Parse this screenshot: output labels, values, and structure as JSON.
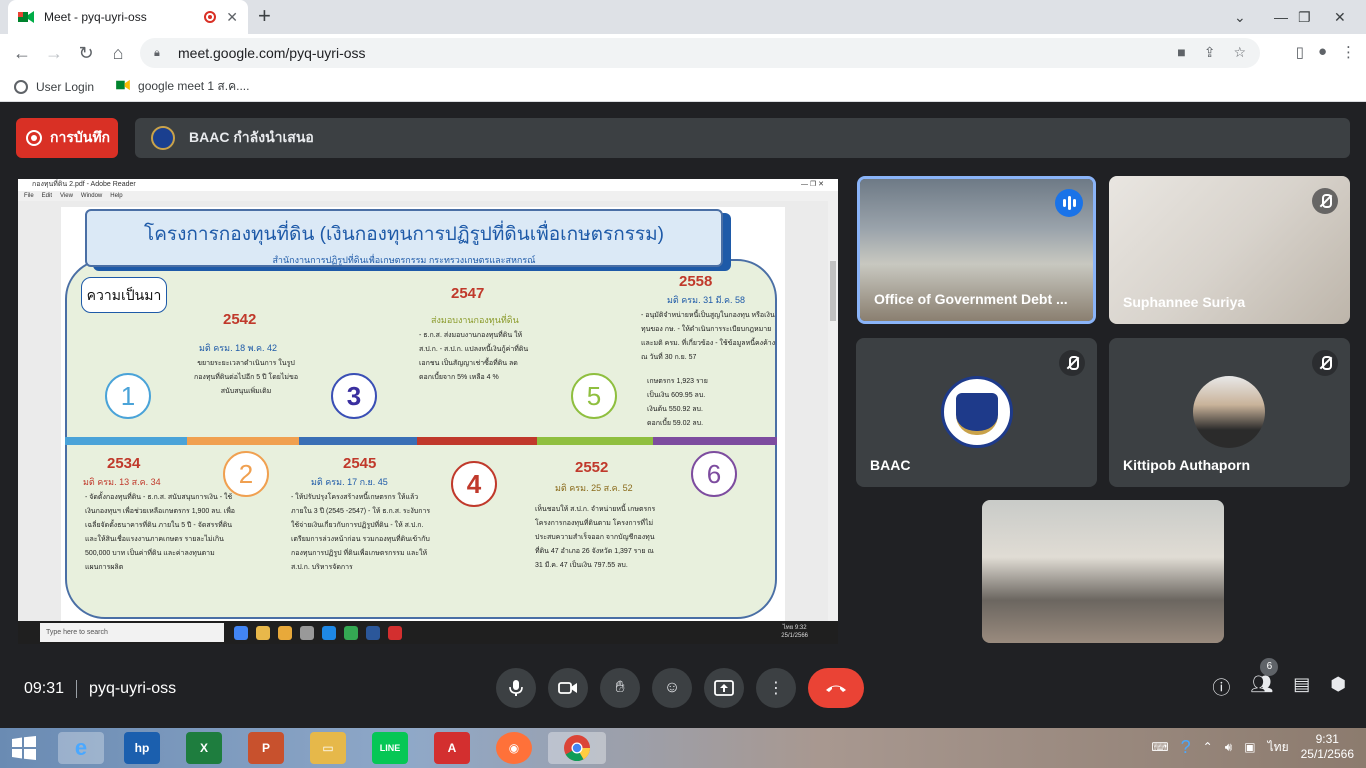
{
  "browser": {
    "tab_title": "Meet - pyq-uyri-oss",
    "tab_close": "✕",
    "new_tab": "+",
    "url": "meet.google.com/pyq-uyri-oss",
    "bookmarks": [
      "User Login",
      "google meet 1 ส.ค...."
    ]
  },
  "meet": {
    "recording_label": "การบันทึก",
    "presenting_label": "BAAC กำลังนำเสนอ",
    "meeting_code": "pyq-uyri-oss",
    "time": "09:31",
    "participant_count": "6"
  },
  "shared_screen": {
    "window_title": "กองทุนที่ดิน 2.pdf - Adobe Reader",
    "menu": [
      "File",
      "Edit",
      "View",
      "Window",
      "Help"
    ],
    "slide_title": "โครงการกองทุนที่ดิน (เงินกองทุนการปฏิรูปที่ดินเพื่อเกษตรกรรม)",
    "slide_subtitle": "สำนักงานการปฏิรูปที่ดินเพื่อเกษตรกรรม กระทรวงเกษตรและสหกรณ์",
    "history_label": "ความเป็นมา",
    "steps": [
      {
        "num": "1",
        "year": "2534",
        "resolution": "มติ ครม. 13 ส.ค. 34",
        "text": "- จัดตั้งกองทุนที่ดิน - ธ.ก.ส. สนับสนุนการเงิน - ใช้เงินกองทุนฯ เพื่อช่วยเหลือเกษตรกร 1,900 ลบ. เพื่อเฉลี่ยจัดตั้งธนาคารที่ดิน ภายใน 5 ปี - จัดสรรที่ดินและให้สินเชื่อแรงงานภาคเกษตร รายละไม่เกิน 500,000 บาท เป็นค่าที่ดิน และค่าลงทุนตามแผนการผลิต"
      },
      {
        "num": "2",
        "year": "2542",
        "resolution": "มติ ครม. 18 พ.ค. 42",
        "text": "ขยายระยะเวลาดำเนินการ ในรูปกองทุนที่ดินต่อไปอีก 5 ปี โดยไม่ขอสนับสนุนเพิ่มเติม"
      },
      {
        "num": "3",
        "year": "2545",
        "resolution": "มติ ครม. 17 ก.ย. 45",
        "text": "- ให้ปรับปรุงโครงสร้างหนี้เกษตรกร ให้แล้วภายใน 3 ปี (2545 -2547) - ให้ ธ.ก.ส. ระงับการใช้จ่ายเงินเกี่ยวกับการปฏิรูปที่ดิน - ให้ ส.ป.ก. เตรียมการล่วงหน้าก่อน รวมกองทุนที่ดินเข้ากับกองทุนการปฏิรูป ที่ดินเพื่อเกษตรกรรม และให้ ส.ป.ก. บริหารจัดการ"
      },
      {
        "num": "4",
        "year": "2547",
        "resolution": "ส่งมอบงานกองทุนที่ดิน",
        "text": "- ธ.ก.ส. ส่งมอบงานกองทุนที่ดิน ให้ ส.ป.ก. - ส.ป.ก. แปลงหนี้เงินกู้ค่าที่ดิน เอกชน เป็นสัญญาเช่าซื้อที่ดิน ลดดอกเบี้ยจาก 5% เหลือ 4 %"
      },
      {
        "num": "5",
        "year": "2552",
        "resolution": "มติ ครม. 25 ส.ค. 52",
        "text": "เห็นชอบให้ ส.ป.ก. จำหน่ายหนี้ เกษตรกรโครงการกองทุนที่ดินตาม โครงการที่ไม่ประสบความสำเร็จออก จากบัญชีกองทุนที่ดิน 47 อำเภอ 26 จังหวัด 1,397 ราย ณ 31 มี.ค. 47 เป็นเงิน 797.55 ลบ."
      },
      {
        "num": "6",
        "year": "2558",
        "resolution": "มติ ครม. 31 มี.ค. 58",
        "text": "- อนุมัติจำหน่ายหนี้เป็นสูญในกองทุน หรือเงินทุนของ กษ. - ให้ดำเนินการระเบียบกฎหมายและมติ ครม. ที่เกี่ยวข้อง - ใช้ข้อมูลหนี้คงค้าง ณ วันที่ 30 ก.ย. 57"
      }
    ],
    "debt_table": [
      {
        "label": "เกษตรกร",
        "value": "1,923",
        "unit": "ราย"
      },
      {
        "label": "เป็นเงิน",
        "value": "609.95",
        "unit": "ลบ."
      },
      {
        "label": "เงินต้น",
        "value": "550.92",
        "unit": "ลบ."
      },
      {
        "label": "ดอกเบี้ย",
        "value": "59.02",
        "unit": "ลบ."
      }
    ],
    "taskbar_search": "Type here to search",
    "clock_time": "9:32",
    "clock_date": "25/1/2566",
    "lang": "ไทย"
  },
  "participants": [
    {
      "name": "Office of Government Debt ...",
      "state": "speaking"
    },
    {
      "name": "Suphannee Suriya",
      "state": "muted"
    },
    {
      "name": "BAAC",
      "state": "muted"
    },
    {
      "name": "Kittipob Authaporn",
      "state": "muted"
    },
    {
      "name": "",
      "state": "self"
    }
  ],
  "os_taskbar": {
    "time": "9:31",
    "date": "25/1/2566",
    "lang": "ไทย",
    "apps": [
      "internet-explorer",
      "hp",
      "excel",
      "powerpoint",
      "file-explorer",
      "line",
      "acrobat",
      "firefox",
      "chrome"
    ]
  },
  "colors": {
    "meet_bg": "#202124",
    "record_red": "#d93025",
    "end_call_red": "#ea4335",
    "speaking_blue": "#1a73e8"
  }
}
